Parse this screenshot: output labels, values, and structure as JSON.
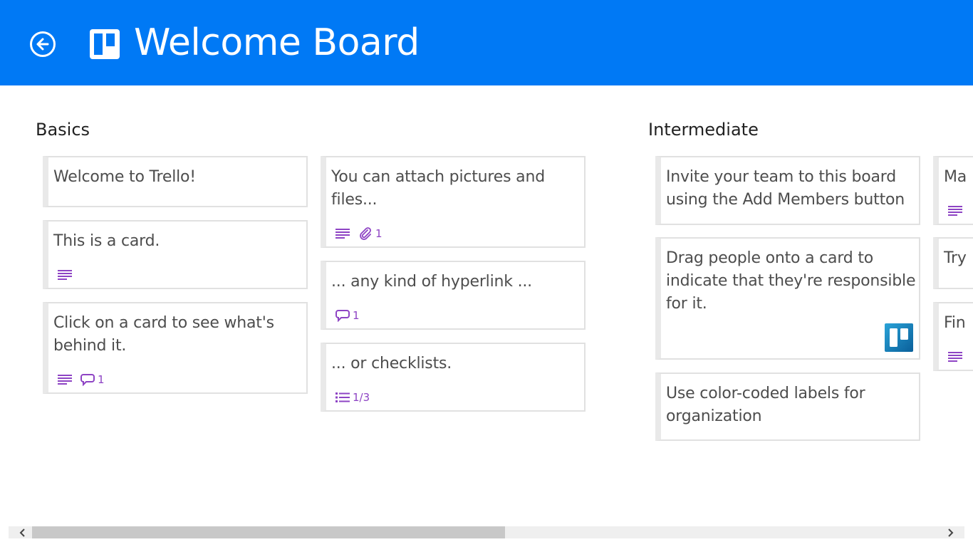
{
  "header": {
    "title": "Welcome Board",
    "back_icon": "back-arrow-icon",
    "logo_icon": "trello-board-icon",
    "background": "#0079f5"
  },
  "lists": [
    {
      "title": "Basics",
      "cards": [
        {
          "text": "Welcome to Trello!",
          "badges": []
        },
        {
          "text": "This is a card.",
          "badges": [
            {
              "icon": "description-icon"
            }
          ]
        },
        {
          "text": "Click on a card to see what's behind it.",
          "badges": [
            {
              "icon": "description-icon"
            },
            {
              "icon": "comment-icon",
              "count": "1"
            }
          ]
        },
        {
          "text": "You can attach pictures and files...",
          "badges": [
            {
              "icon": "description-icon"
            },
            {
              "icon": "attachment-icon",
              "count": "1"
            }
          ]
        },
        {
          "text": "... any kind of hyperlink ...",
          "badges": [
            {
              "icon": "comment-icon",
              "count": "1"
            }
          ]
        },
        {
          "text": "... or checklists.",
          "badges": [
            {
              "icon": "checklist-icon",
              "count": "1/3"
            }
          ]
        }
      ]
    },
    {
      "title": "Intermediate",
      "cards": [
        {
          "text": "Invite your team to this board using the Add Members button",
          "badges": []
        },
        {
          "text": "Drag people onto a card to indicate that they're responsible for it.",
          "badges": [],
          "member": "trello-member-avatar"
        },
        {
          "text": "Use color-coded labels for organization",
          "badges": []
        },
        {
          "text": "Ma",
          "badges": [
            {
              "icon": "description-icon"
            }
          ]
        },
        {
          "text": "Try",
          "badges": []
        },
        {
          "text": "Fin",
          "badges": [
            {
              "icon": "description-icon"
            }
          ]
        }
      ]
    }
  ],
  "scrollbar": {
    "left_icon": "chevron-left-icon",
    "right_icon": "chevron-right-icon",
    "position_fraction": 0.5
  },
  "colors": {
    "accent": "#0079f5",
    "badge": "#8e44c4",
    "card_border": "#e1e1e1"
  }
}
